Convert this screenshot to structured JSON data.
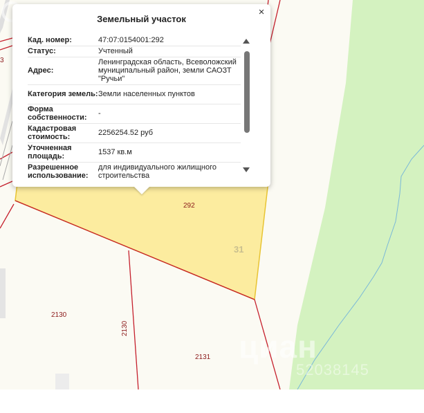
{
  "map": {
    "plots": [
      {
        "label": "292"
      },
      {
        "label": "31"
      },
      {
        "label": "2130"
      },
      {
        "label": "2130"
      },
      {
        "label": "2131"
      },
      {
        "label": "3"
      }
    ],
    "colors": {
      "background": "#fbfaf3",
      "forest": "#d4f2c0",
      "selected_plot_fill": "#fcec9f",
      "selected_plot_stroke": "#e8c433",
      "boundary": "#c51f2c",
      "stream": "#79b8d8"
    },
    "watermark": {
      "brand": "циан",
      "listing_id": "52038145"
    }
  },
  "popup": {
    "title": "Земельный участок",
    "close_label": "×",
    "rows": [
      {
        "key": "Кад. номер:",
        "value": "47:07:0154001:292"
      },
      {
        "key": "Статус:",
        "value": "Учтенный"
      },
      {
        "key": "Адрес:",
        "value": "Ленинградская область, Всеволожский муниципальный район, земли САОЗТ \"Ручьи\""
      },
      {
        "key": "Категория земель:",
        "value": "Земли населенных пунктов"
      },
      {
        "key": "Форма собственности:",
        "value": "-"
      },
      {
        "key": "Кадастровая стоимость:",
        "value": "2256254.52 руб"
      },
      {
        "key": "Уточненная площадь:",
        "value": "1537 кв.м"
      },
      {
        "key": "Разрешенное использование:",
        "value": "для индивидуального жилищного строительства"
      }
    ]
  }
}
